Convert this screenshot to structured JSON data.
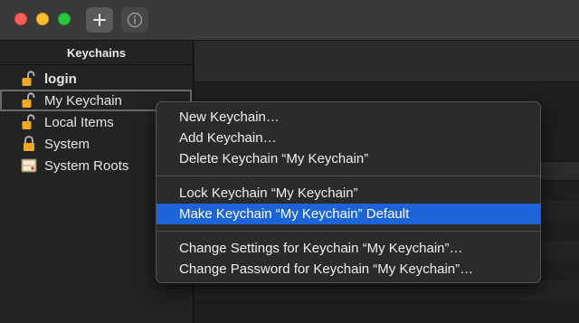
{
  "toolbar": {
    "add_icon": "plus-icon",
    "info_icon": "info-icon"
  },
  "sidebar": {
    "header": "Keychains",
    "items": [
      {
        "label": "login",
        "icon": "unlocked-padlock-icon"
      },
      {
        "label": "My Keychain",
        "icon": "unlocked-padlock-icon"
      },
      {
        "label": "Local Items",
        "icon": "unlocked-padlock-icon"
      },
      {
        "label": "System",
        "icon": "locked-padlock-icon"
      },
      {
        "label": "System Roots",
        "icon": "certificate-cabinet-icon"
      }
    ]
  },
  "context_menu": {
    "items": [
      "New Keychain…",
      "Add Keychain…",
      "Delete Keychain “My Keychain”",
      "Lock Keychain “My Keychain”",
      "Make Keychain “My Keychain” Default",
      "Change Settings for Keychain “My Keychain”…",
      "Change Password for Keychain “My Keychain”…"
    ],
    "highlighted": "Make Keychain “My Keychain” Default"
  },
  "colors": {
    "highlight": "#1d64d8",
    "close": "#fe5f57",
    "minimize": "#febc2e",
    "zoom": "#28c840",
    "lock_gold": "#f0a81e"
  }
}
